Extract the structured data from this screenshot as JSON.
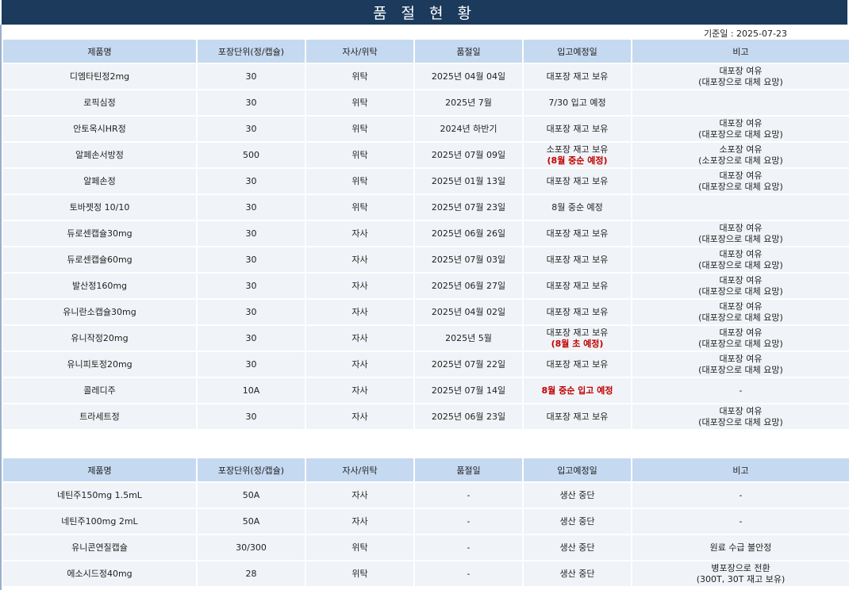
{
  "title": "품 절 현 황",
  "reference_date": "기준일 : 2025-07-23",
  "headers": [
    "제품명",
    "포장단위(정/캡슐)",
    "자사/위탁",
    "품절일",
    "입고예정일",
    "비고"
  ],
  "table1": [
    {
      "name": "디엠타틴정2mg",
      "unit": "30",
      "type": "위탁",
      "soldout": "2025년 04월 04일",
      "eta": [
        "대포장 재고 보유"
      ],
      "eta_red": "",
      "note": [
        "대포장 여유",
        "(대포장으로 대체 요망)"
      ]
    },
    {
      "name": "로픽심정",
      "unit": "30",
      "type": "위탁",
      "soldout": "2025년 7월",
      "eta": [
        "7/30 입고 예정"
      ],
      "eta_red": "",
      "note": []
    },
    {
      "name": "안토옥시HR정",
      "unit": "30",
      "type": "위탁",
      "soldout": "2024년 하반기",
      "eta": [
        "대포장 재고 보유"
      ],
      "eta_red": "",
      "note": [
        "대포장 여유",
        "(대포장으로 대체 요망)"
      ]
    },
    {
      "name": "알페손서방정",
      "unit": "500",
      "type": "위탁",
      "soldout": "2025년 07월 09일",
      "eta": [
        "소포장 재고 보유"
      ],
      "eta_red": "(8월 중순 예정)",
      "note": [
        "소포장 여유",
        "(소포장으로 대체 요망)"
      ]
    },
    {
      "name": "알페손정",
      "unit": "30",
      "type": "위탁",
      "soldout": "2025년 01월 13일",
      "eta": [
        "대포장 재고 보유"
      ],
      "eta_red": "",
      "note": [
        "대포장 여유",
        "(대포장으로 대체 요망)"
      ]
    },
    {
      "name": "토바젯정 10/10",
      "unit": "30",
      "type": "위탁",
      "soldout": "2025년 07월 23일",
      "eta": [
        "8월 중순 예정"
      ],
      "eta_red": "",
      "note": []
    },
    {
      "name": "듀로센캡슐30mg",
      "unit": "30",
      "type": "자사",
      "soldout": "2025년 06월 26일",
      "eta": [
        "대포장 재고 보유"
      ],
      "eta_red": "",
      "note": [
        "대포장 여유",
        "(대포장으로 대체 요망)"
      ]
    },
    {
      "name": "듀로센캡슐60mg",
      "unit": "30",
      "type": "자사",
      "soldout": "2025년 07월 03일",
      "eta": [
        "대포장 재고 보유"
      ],
      "eta_red": "",
      "note": [
        "대포장 여유",
        "(대포장으로 대체 요망)"
      ]
    },
    {
      "name": "발산정160mg",
      "unit": "30",
      "type": "자사",
      "soldout": "2025년 06월 27일",
      "eta": [
        "대포장 재고 보유"
      ],
      "eta_red": "",
      "note": [
        "대포장 여유",
        "(대포장으로 대체 요망)"
      ]
    },
    {
      "name": "유니란소캡슐30mg",
      "unit": "30",
      "type": "자사",
      "soldout": "2025년 04월 02일",
      "eta": [
        "대포장 재고 보유"
      ],
      "eta_red": "",
      "note": [
        "대포장 여유",
        "(대포장으로 대체 요망)"
      ]
    },
    {
      "name": "유니작정20mg",
      "unit": "30",
      "type": "자사",
      "soldout": "2025년 5월",
      "eta": [
        "대포장 재고 보유"
      ],
      "eta_red": "(8월 초 예정)",
      "note": [
        "대포장 여유",
        "(대포장으로 대체 요망)"
      ]
    },
    {
      "name": "유니피토정20mg",
      "unit": "30",
      "type": "자사",
      "soldout": "2025년 07월 22일",
      "eta": [
        "대포장 재고 보유"
      ],
      "eta_red": "",
      "note": [
        "대포장 여유",
        "(대포장으로 대체 요망)"
      ]
    },
    {
      "name": "콜레디주",
      "unit": "10A",
      "type": "자사",
      "soldout": "2025년 07월 14일",
      "eta": [],
      "eta_red": "8월 중순 입고 예정",
      "note": [
        "-"
      ]
    },
    {
      "name": "트라세트정",
      "unit": "30",
      "type": "자사",
      "soldout": "2025년 06월 23일",
      "eta": [
        "대포장 재고 보유"
      ],
      "eta_red": "",
      "note": [
        "대포장 여유",
        "(대포장으로 대체 요망)"
      ]
    }
  ],
  "table2": [
    {
      "name": "네틴주150mg 1.5mL",
      "unit": "50A",
      "type": "자사",
      "soldout": "-",
      "eta": [
        "생산 중단"
      ],
      "eta_red": "",
      "note": [
        "-"
      ]
    },
    {
      "name": "네틴주100mg 2mL",
      "unit": "50A",
      "type": "자사",
      "soldout": "-",
      "eta": [
        "생산 중단"
      ],
      "eta_red": "",
      "note": [
        "-"
      ]
    },
    {
      "name": "유니콘연질캡슐",
      "unit": "30/300",
      "type": "위탁",
      "soldout": "-",
      "eta": [
        "생산 중단"
      ],
      "eta_red": "",
      "note": [
        "원료 수급 불안정"
      ]
    },
    {
      "name": "에소시드정40mg",
      "unit": "28",
      "type": "위탁",
      "soldout": "-",
      "eta": [
        "생산 중단"
      ],
      "eta_red": "",
      "note": [
        "병포장으로 전환",
        "(300T, 30T 재고 보유)"
      ]
    }
  ]
}
